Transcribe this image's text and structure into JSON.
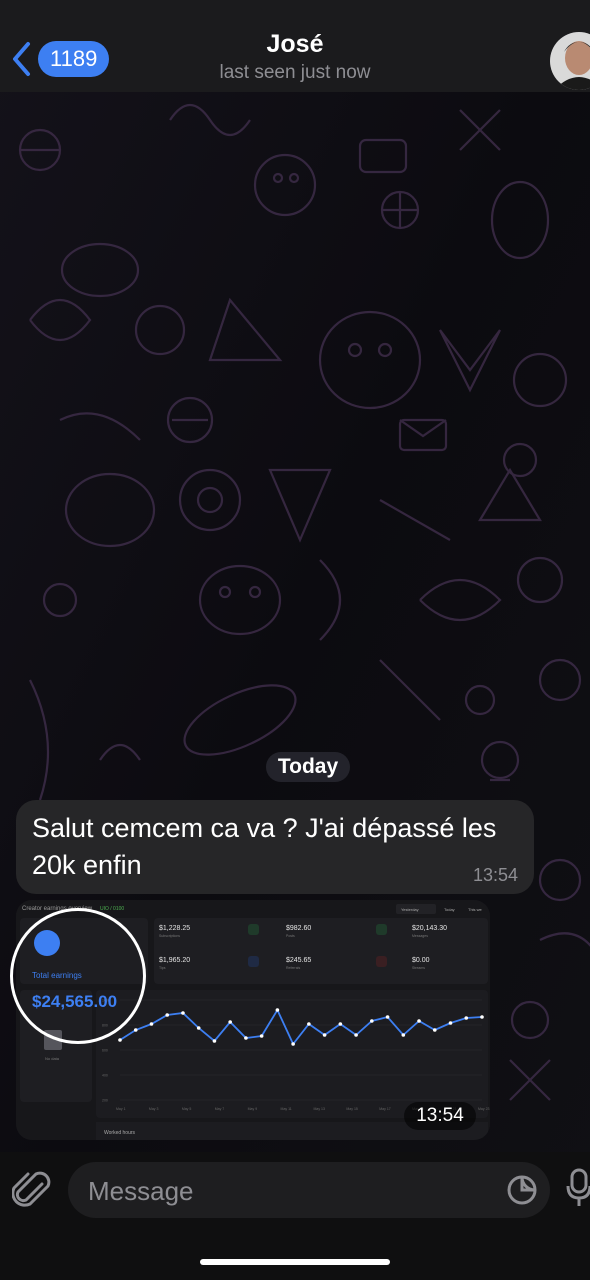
{
  "header": {
    "back_count": "1189",
    "title": "José",
    "status": "last seen just now"
  },
  "date_pill": "Today",
  "message": {
    "text": "Salut cemcem ca va ? J'ai dépassé les 20k enfin",
    "time": "13:54"
  },
  "image_message": {
    "time": "13:54",
    "dashboard": {
      "title": "Creator earnings overview",
      "tag": "UIO / 0100",
      "tabs": [
        "Yesterday",
        "Today",
        "This we"
      ],
      "total_label": "Total earnings",
      "total_value": "$24,565.00",
      "stats": [
        {
          "value": "$1,228.25",
          "label": "Subscriptions"
        },
        {
          "value": "$982.60",
          "label": "Posts"
        },
        {
          "value": "$20,143.30",
          "label": "Messages"
        },
        {
          "value": "$1,965.20",
          "label": "Tips"
        },
        {
          "value": "$245.65",
          "label": "Referrals"
        },
        {
          "value": "$0.00",
          "label": "Streams"
        }
      ],
      "sidebar_label": "No data",
      "section_label": "Worked hours",
      "y_ticks": [
        "1000",
        "800",
        "600",
        "400",
        "200"
      ],
      "x_ticks": [
        "May 1",
        "May 3",
        "May 5",
        "May 7",
        "May 9",
        "May 11",
        "May 13",
        "May 15",
        "May 17",
        "May 19",
        "May 21",
        "May 23"
      ]
    }
  },
  "input": {
    "placeholder": "Message"
  },
  "colors": {
    "accent": "#3d7ff2",
    "bubble": "#262628",
    "header": "#1b1b1d"
  },
  "chart_data": {
    "type": "line",
    "title": "",
    "xlabel": "",
    "ylabel": "",
    "x": [
      "May 1",
      "May 3",
      "May 5",
      "May 7",
      "May 9",
      "May 11",
      "May 13",
      "May 15",
      "May 17",
      "May 19",
      "May 21",
      "May 23"
    ],
    "values": [
      600,
      700,
      760,
      850,
      870,
      720,
      590,
      780,
      620,
      640,
      900,
      560,
      760,
      650,
      760,
      650,
      790,
      830,
      650,
      790,
      700,
      770,
      820,
      830
    ],
    "ylim": [
      0,
      1000
    ],
    "grid": true
  }
}
